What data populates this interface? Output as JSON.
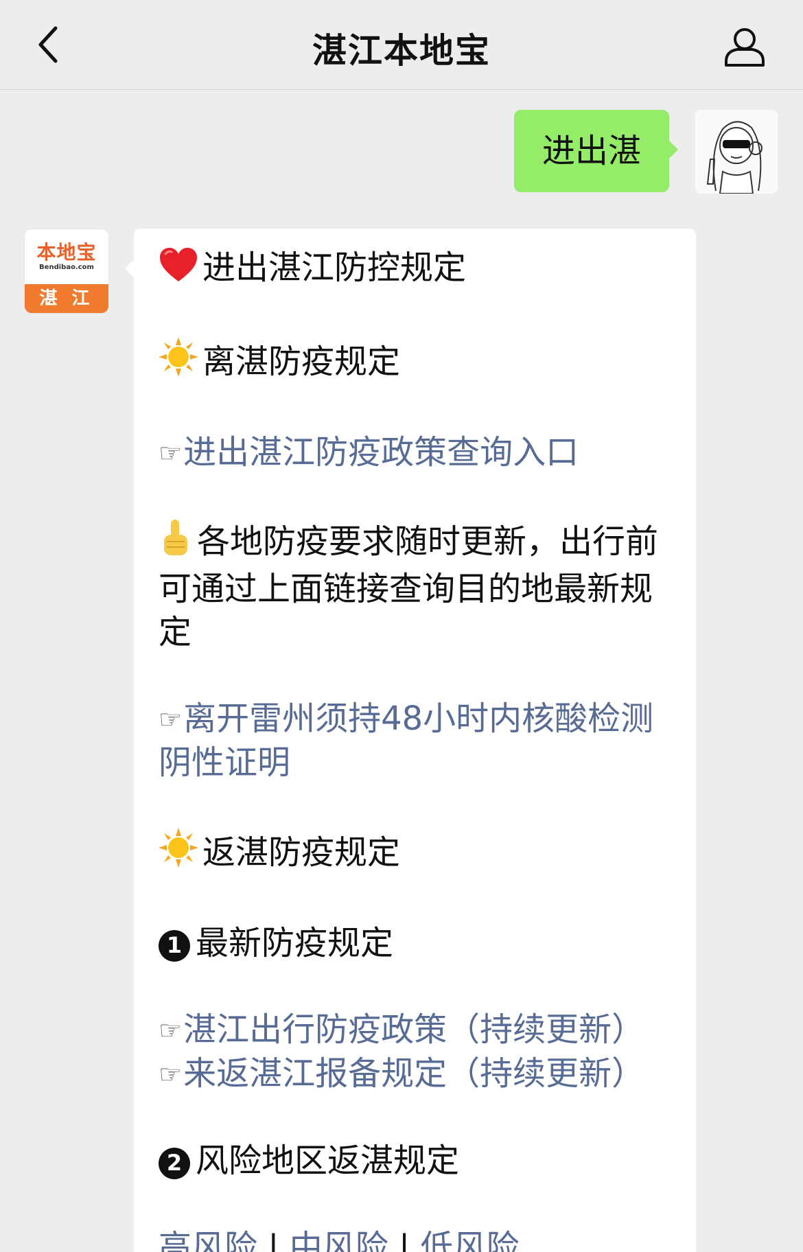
{
  "header": {
    "title": "湛江本地宝"
  },
  "outgoing": {
    "text": "进出湛"
  },
  "bot_avatar": {
    "logo_cn": "本地宝",
    "logo_en": "Bendibao.com",
    "city": "湛 江"
  },
  "message": {
    "heading": "进出湛江防控规定",
    "leave_title": "离湛防疫规定",
    "link_query": "进出湛江防疫政策查询入口",
    "note": "各地防疫要求随时更新，出行前可通过上面链接查询目的地最新规定",
    "link_leizhou": "离开雷州须持48小时内核酸检测阴性证明",
    "return_title": "返湛防疫规定",
    "section1_title": "最新防疫规定",
    "section1_num": "1",
    "link_policy": "湛江出行防疫政策（持续更新）",
    "link_report": "来返湛江报备规定（持续更新）",
    "section2_title": "风险地区返湛规定",
    "section2_num": "2",
    "risk_high": "高风险",
    "risk_mid": "中风险",
    "risk_low": "低风险",
    "separator": "|"
  },
  "colors": {
    "link": "#576b95",
    "outgoing_bubble": "#95ec69",
    "background": "#ededed",
    "brand_orange": "#f07a2e"
  }
}
